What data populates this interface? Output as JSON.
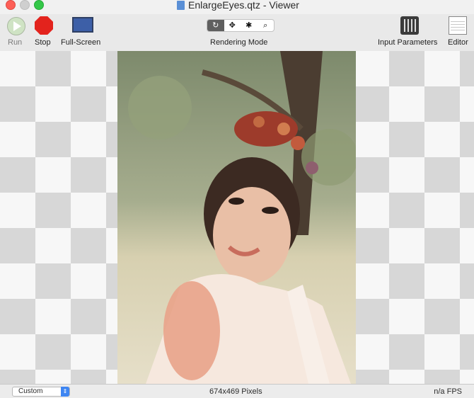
{
  "window": {
    "title": "EnlargeEyes.qtz - Viewer"
  },
  "toolbar": {
    "run_label": "Run",
    "stop_label": "Stop",
    "fullscreen_label": "Full-Screen",
    "rendering_mode_label": "Rendering Mode",
    "rendering_modes": [
      {
        "icon": "rotate-icon",
        "glyph": "↻",
        "selected": true
      },
      {
        "icon": "move-icon",
        "glyph": "✥",
        "selected": false
      },
      {
        "icon": "bug-icon",
        "glyph": "✱",
        "selected": false
      },
      {
        "icon": "zoom-icon",
        "glyph": "⌕",
        "selected": false
      }
    ],
    "input_parameters_label": "Input Parameters",
    "editor_label": "Editor"
  },
  "statusbar": {
    "size_select_value": "Custom",
    "dimensions": "674x469 Pixels",
    "fps": "n/a FPS"
  },
  "colors": {
    "checker_dark": "#d7d7d7",
    "checker_light": "#f7f7f7",
    "stop_red": "#e3231d",
    "select_blue": "#3f86f2"
  }
}
